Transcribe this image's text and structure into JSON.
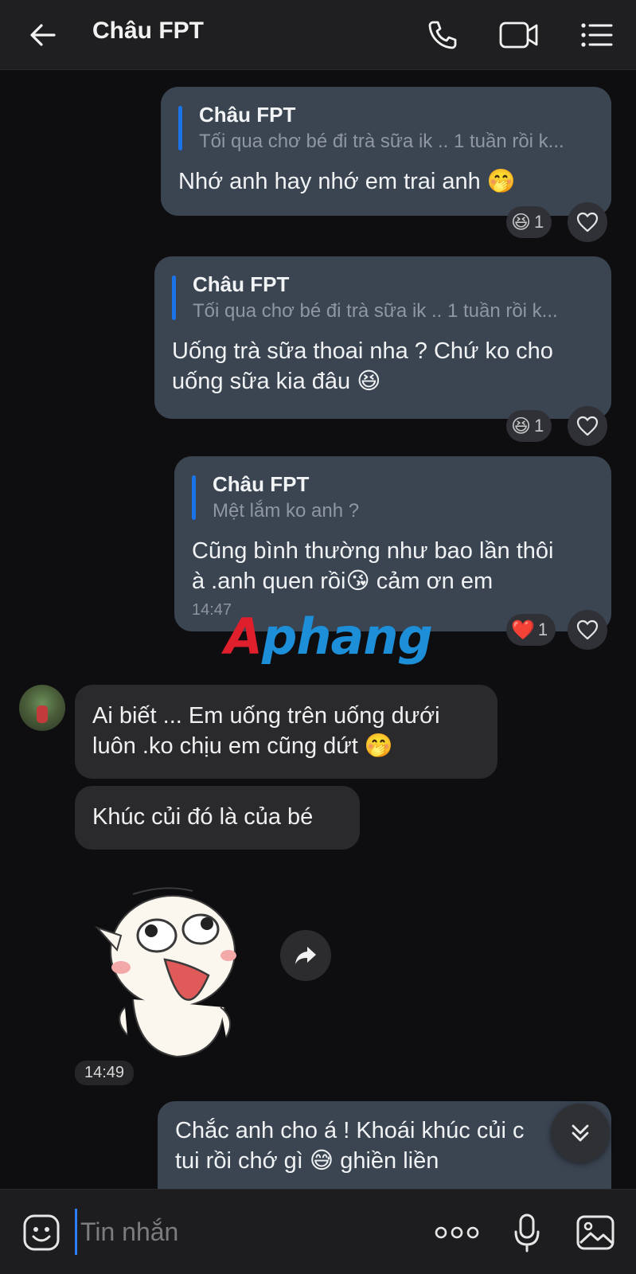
{
  "header": {
    "title": "Châu FPT",
    "back_icon": "arrow-left-icon",
    "call_icon": "phone-icon",
    "video_icon": "video-camera-icon",
    "menu_icon": "list-menu-icon"
  },
  "messages": {
    "m1": {
      "reply_name": "Châu FPT",
      "reply_text": "Tối qua chơ bé đi trà sữa ik .. 1 tuần rồi k...",
      "text": "Nhớ anh hay nhớ em trai anh 🤭",
      "reaction_emoji": "😆",
      "reaction_count": "1"
    },
    "m2": {
      "reply_name": "Châu FPT",
      "reply_text": "Tối qua chơ bé đi trà sữa ik .. 1 tuần rồi k...",
      "text_line1": "Uống trà sữa thoai nha ? Chứ ko cho",
      "text_line2": "uống sữa kia đâu 😆",
      "reaction_emoji": "😆",
      "reaction_count": "1"
    },
    "m3": {
      "reply_name": "Châu FPT",
      "reply_text": "Mệt lắm ko anh ?",
      "text_line1": "Cũng bình thường như bao lần thôi",
      "text_line2": "à .anh quen rồi😘 cảm ơn em",
      "time": "14:47",
      "reaction_emoji": "❤️",
      "reaction_count": "1"
    },
    "in1": {
      "text_line1": "Ai biết ... Em uống trên uống dưới",
      "text_line2": "luôn .ko chịu em cũng dứt 🤭"
    },
    "in2": {
      "text": "Khúc củi đó là của bé"
    },
    "sticker_time": "14:49",
    "m4": {
      "text_line1": "Chắc anh cho á ! Khoái khúc củi c",
      "text_line2": "tui rồi chớ gì 😅 ghiền liền"
    }
  },
  "watermark": {
    "part1": "A",
    "part2": "phang"
  },
  "input": {
    "placeholder": "Tin nhắn",
    "emoji_icon": "emoji-icon",
    "more_icon": "more-dots-icon",
    "mic_icon": "microphone-icon",
    "image_icon": "image-icon"
  },
  "colors": {
    "outgoing_bubble": "#3b4552",
    "incoming_bubble": "#2a2a2d",
    "accent": "#1a73e8",
    "background": "#0e0e10"
  }
}
